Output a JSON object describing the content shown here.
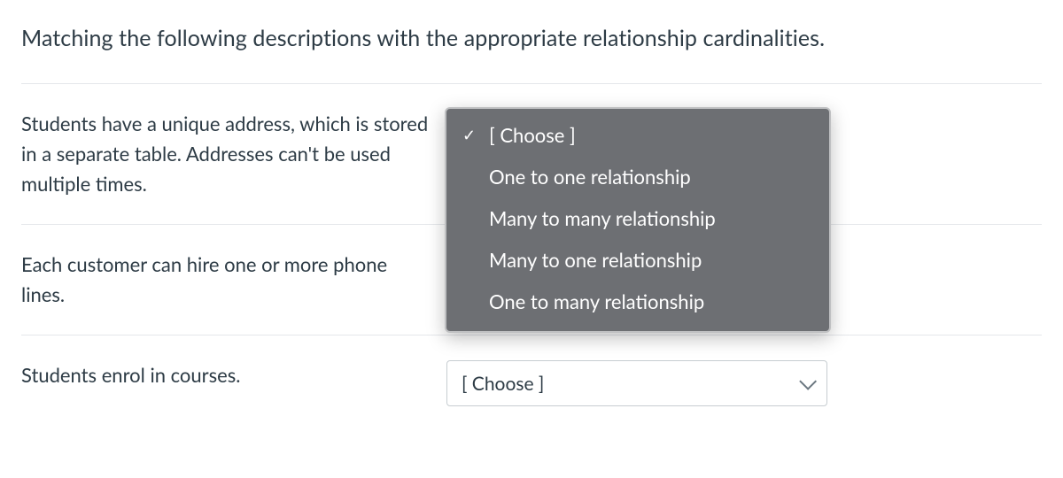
{
  "question": "Matching the following descriptions with the appropriate relationship cardinalities.",
  "rows": [
    {
      "desc": "Students have a unique address, which is stored in a separate table. Addresses can't be used multiple times.",
      "selectedLabel": "[ Choose ]",
      "open": true,
      "options": [
        {
          "label": "[ Choose ]",
          "checked": true
        },
        {
          "label": "One to one relationship",
          "checked": false
        },
        {
          "label": "Many to many relationship",
          "checked": false
        },
        {
          "label": "Many to one relationship",
          "checked": false
        },
        {
          "label": "One to many relationship",
          "checked": false
        }
      ]
    },
    {
      "desc": "Each customer can hire one or more phone lines.",
      "selectedLabel": "[ Choose ]",
      "open": false
    },
    {
      "desc": "Students enrol in courses.",
      "selectedLabel": "[ Choose ]",
      "open": false
    }
  ]
}
